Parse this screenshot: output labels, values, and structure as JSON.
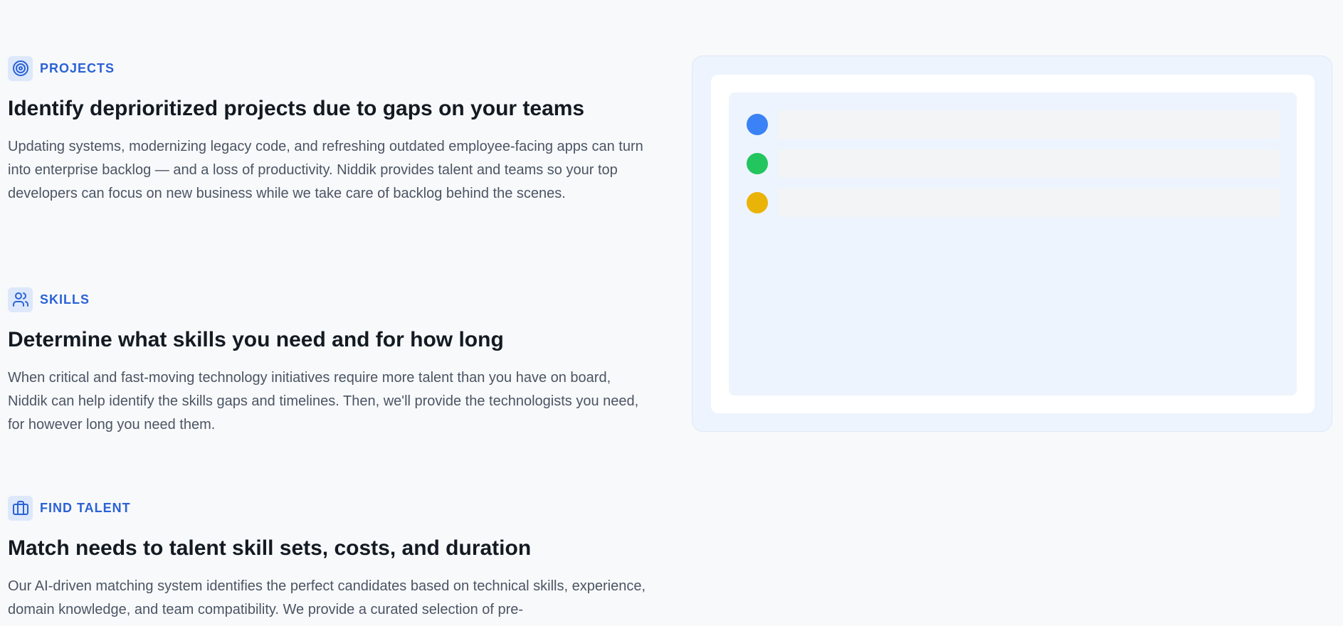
{
  "features": [
    {
      "eyebrow": "PROJECTS",
      "icon": "target-icon",
      "title": "Identify deprioritized projects due to gaps on your teams",
      "body": "Updating systems, modernizing legacy code, and refreshing outdated employee-facing apps can turn into enterprise backlog — and a loss of productivity. Niddik provides talent and teams so your top developers can focus on new business while we take care of backlog behind the scenes."
    },
    {
      "eyebrow": "SKILLS",
      "icon": "users-icon",
      "title": "Determine what skills you need and for how long",
      "body": "When critical and fast-moving technology initiatives require more talent than you have on board, Niddik can help identify the skills gaps and timelines. Then, we'll provide the technologists you need, for however long you need them."
    },
    {
      "eyebrow": "FIND TALENT",
      "icon": "briefcase-icon",
      "title": "Match needs to talent skill sets, costs, and duration",
      "body": "Our AI-driven matching system identifies the perfect candidates based on technical skills, experience, domain knowledge, and team compatibility. We provide a curated selection of pre-"
    }
  ],
  "mockup": {
    "rows": [
      {
        "dot_color": "#3b82f6"
      },
      {
        "dot_color": "#22c55e"
      },
      {
        "dot_color": "#eab308"
      }
    ]
  },
  "colors": {
    "accent": "#2a62d6",
    "heading": "#131a22",
    "body_text": "#4b5563",
    "background": "#f8f9fb"
  }
}
